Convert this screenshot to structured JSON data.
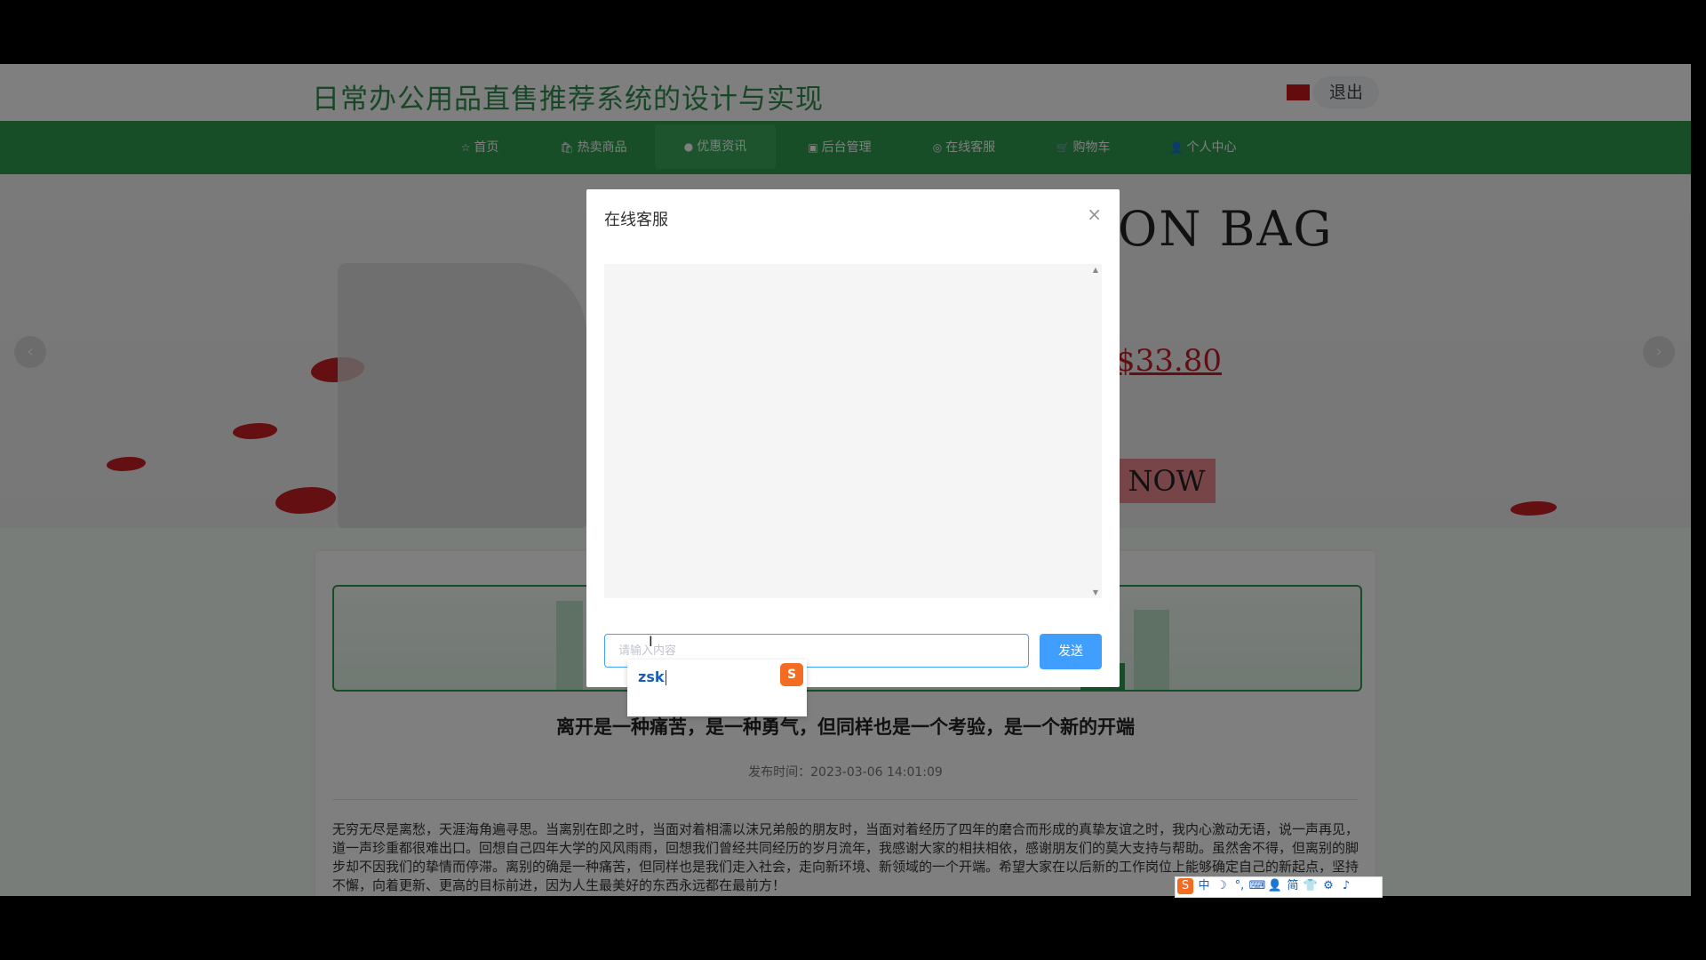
{
  "site": {
    "title": "日常办公用品直售推荐系统的设计与实现",
    "logout_label": "退出",
    "flag_color": "#c8161d"
  },
  "nav": {
    "items": [
      {
        "label": "首页",
        "icon": "star-icon"
      },
      {
        "label": "热卖商品",
        "icon": "bag-icon"
      },
      {
        "label": "优惠资讯",
        "icon": "info-circle-icon"
      },
      {
        "label": "后台管理",
        "icon": "briefcase-icon"
      },
      {
        "label": "在线客服",
        "icon": "headset-icon"
      },
      {
        "label": "购物车",
        "icon": "cart-icon"
      },
      {
        "label": "个人中心",
        "icon": "user-icon"
      }
    ],
    "active_index": 2,
    "color": "#2e9a4e"
  },
  "banner": {
    "heading": "ON BAG",
    "price": "$33.80",
    "button_label": "NOW",
    "prev_icon": "chevron-left-icon",
    "next_icon": "chevron-right-icon"
  },
  "article": {
    "title": "离开是一种痛苦，是一种勇气，但同样也是一个考验，是一个新的开端",
    "publish_label": "发布时间：",
    "publish_time": "2023-03-06 14:01:09",
    "body": "无穷无尽是离愁，天涯海角遍寻思。当离别在即之时，当面对着相濡以沫兄弟般的朋友时，当面对着经历了四年的磨合而形成的真挚友谊之时，我内心激动无语，说一声再见，道一声珍重都很难出口。回想自己四年大学的风风雨雨，回想我们曾经共同经历的岁月流年，我感谢大家的相扶相依，感谢朋友们的莫大支持与帮助。虽然舍不得，但离别的脚步却不因我们的挚情而停滞。离别的确是一种痛苦，但同样也是我们走入社会，走向新环境、新领域的一个开端。希望大家在以后新的工作岗位上能够确定自己的新起点，坚持不懈，向着更新、更高的目标前进，因为人生最美好的东西永远都在最前方！"
  },
  "dialog": {
    "title": "在线客服",
    "close_icon": "close-icon",
    "input_placeholder": "请输入内容",
    "send_label": "发送"
  },
  "ime": {
    "composition": "zsk",
    "logo": "sogou-ime-icon",
    "toolbar": [
      "中",
      "☽",
      "°,",
      "⌨",
      "👤",
      "简",
      "👕",
      "⚙",
      "♪"
    ]
  }
}
